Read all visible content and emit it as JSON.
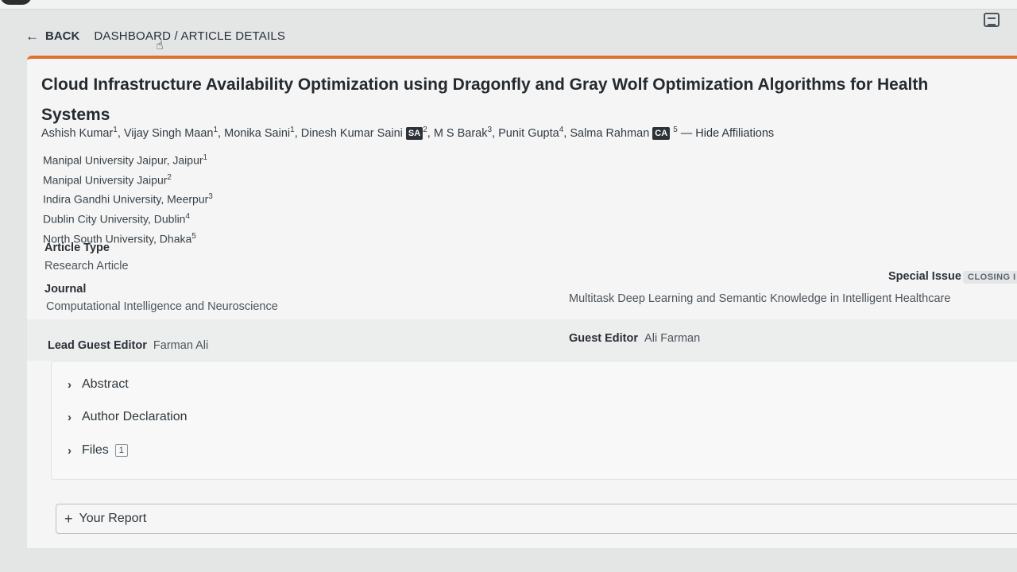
{
  "nav": {
    "back_label": "BACK",
    "breadcrumb_dashboard": "DASHBOARD",
    "breadcrumb_separator": " / ",
    "breadcrumb_current": "ARTICLE DETAILS"
  },
  "article": {
    "title": "Cloud Infrastructure Availability Optimization using Dragonfly and Gray Wolf Optimization Algorithms for Health Systems",
    "authors": [
      {
        "name": "Ashish Kumar",
        "aff": "1"
      },
      {
        "name": "Vijay Singh Maan",
        "aff": "1"
      },
      {
        "name": "Monika Saini",
        "aff": "1"
      },
      {
        "name": "Dinesh Kumar Saini",
        "badge": "SA",
        "aff": "2"
      },
      {
        "name": "M S Barak",
        "aff": "3"
      },
      {
        "name": "Punit Gupta",
        "aff": "4"
      },
      {
        "name": "Salma Rahman",
        "badge": "CA",
        "aff": "5"
      }
    ],
    "hide_affiliations": "— Hide Affiliations",
    "affiliations": [
      {
        "text": "Manipal University Jaipur, Jaipur",
        "num": "1"
      },
      {
        "text": "Manipal University Jaipur",
        "num": "2"
      },
      {
        "text": "Indira Gandhi University, Meerpur",
        "num": "3"
      },
      {
        "text": "Dublin City University, Dublin",
        "num": "4"
      },
      {
        "text": "North South University, Dhaka",
        "num": "5"
      }
    ],
    "article_type_label": "Article Type",
    "article_type_value": "Research Article",
    "journal_label": "Journal",
    "journal_value": "Computational Intelligence and Neuroscience",
    "special_issue_label": "Special Issue",
    "special_issue_chip": "CLOSING I",
    "special_issue_value": "Multitask Deep Learning and Semantic Knowledge in Intelligent Healthcare",
    "lead_guest_editor_label": "Lead Guest Editor",
    "lead_guest_editor_value": "Farman Ali",
    "guest_editor_label": "Guest Editor",
    "guest_editor_value": "Ali Farman"
  },
  "sections": {
    "abstract": "Abstract",
    "author_declaration": "Author Declaration",
    "files": "Files",
    "files_count": "1"
  },
  "report": {
    "plus": "+",
    "label": "Your Report"
  }
}
